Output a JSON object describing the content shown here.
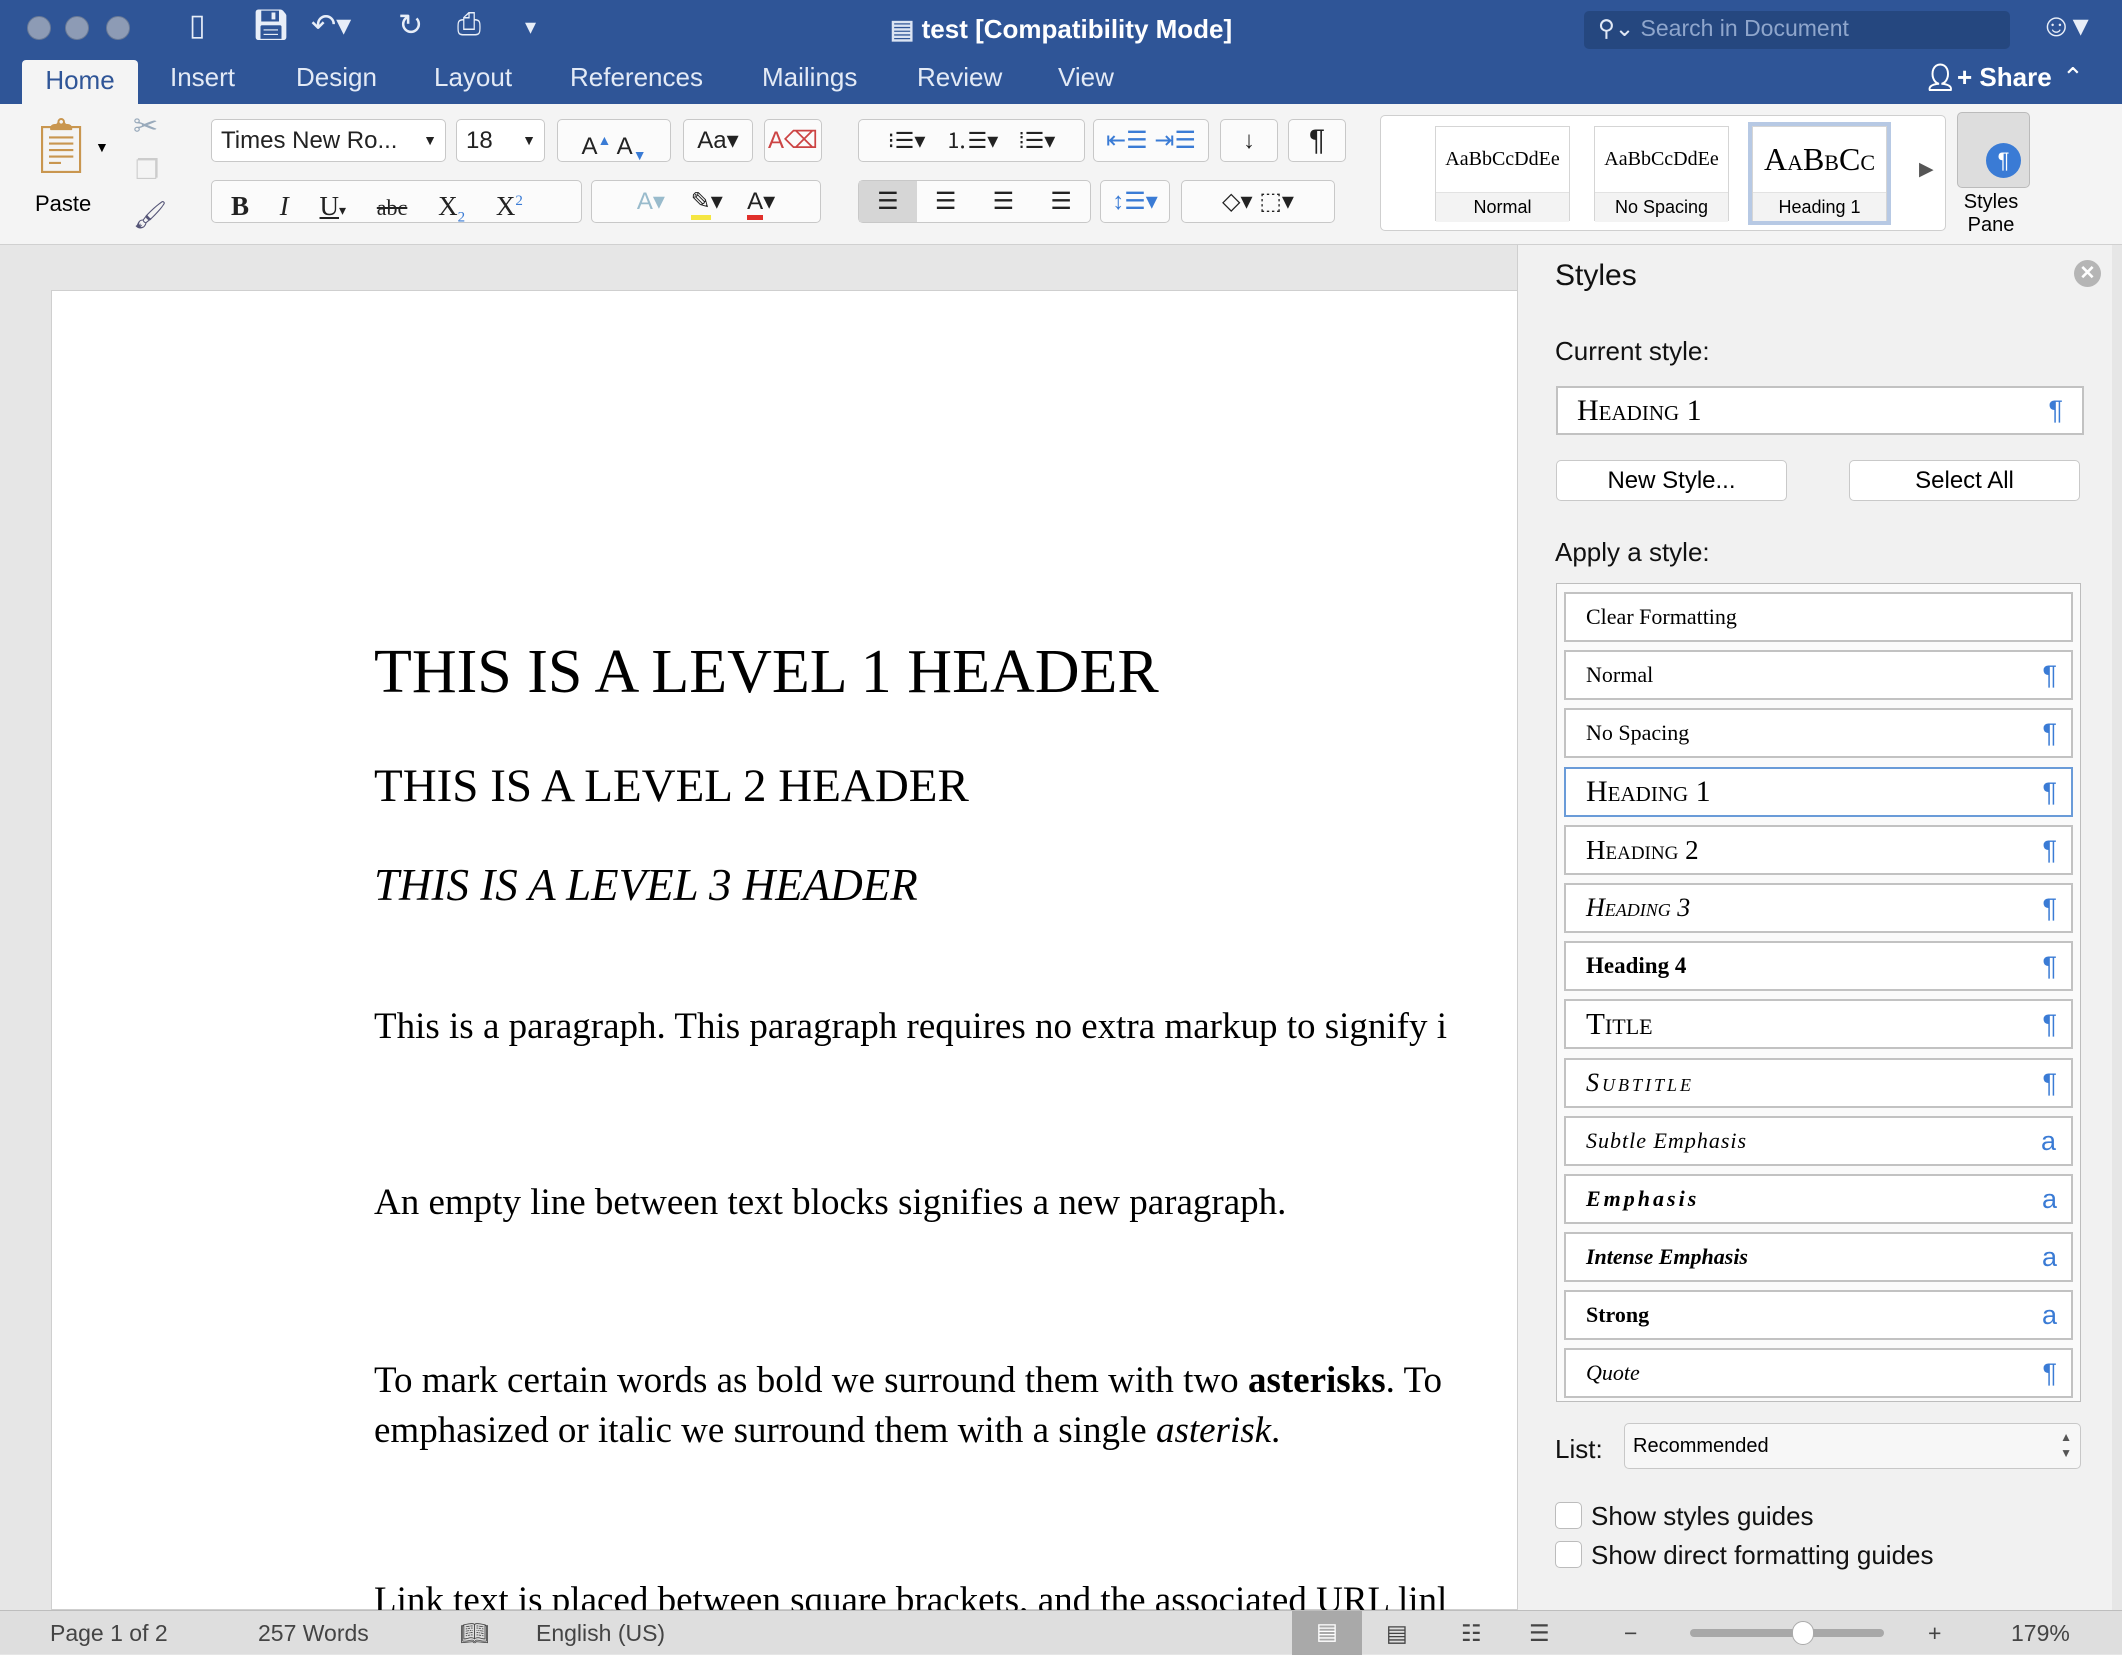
{
  "window": {
    "title": "test [Compatibility Mode]",
    "search_placeholder": "Search in Document",
    "share_label": "Share"
  },
  "tabs": [
    {
      "label": "Home",
      "active": true
    },
    {
      "label": "Insert"
    },
    {
      "label": "Design"
    },
    {
      "label": "Layout"
    },
    {
      "label": "References"
    },
    {
      "label": "Mailings"
    },
    {
      "label": "Review"
    },
    {
      "label": "View"
    }
  ],
  "ribbon": {
    "paste_label": "Paste",
    "font_name": "Times New Ro...",
    "font_size": "18",
    "styles_pane_label": "Styles Pane",
    "gallery": [
      {
        "preview": "AaBbCcDdEe",
        "label": "Normal"
      },
      {
        "preview": "AaBbCcDdEe",
        "label": "No Spacing"
      },
      {
        "preview": "AaBbCc",
        "label": "Heading 1",
        "selected": true
      }
    ]
  },
  "document": {
    "h1": "THIS IS A LEVEL 1 HEADER",
    "h2": "THIS IS A LEVEL 2 HEADER",
    "h3": "THIS IS A LEVEL 3 HEADER",
    "p1": "This is a paragraph. This paragraph requires no extra markup to signify i",
    "p2": "An empty line between text blocks signifies a new paragraph.",
    "p3_a": "To mark certain words as bold we surround them with two ",
    "p3_bold": "asterisks",
    "p3_b": ". To",
    "p3_c": "emphasized or italic we surround them with a single ",
    "p3_italic": "asterisk",
    "p3_d": ".",
    "p4": "Link text is placed between square brackets, and the associated URL linl"
  },
  "styles_pane": {
    "title": "Styles",
    "current_style_label": "Current style:",
    "current_style": "Heading 1",
    "new_style": "New Style...",
    "select_all": "Select All",
    "apply_label": "Apply a style:",
    "styles": [
      {
        "name": "Clear Formatting",
        "marker": ""
      },
      {
        "name": "Normal",
        "marker": "¶"
      },
      {
        "name": "No Spacing",
        "marker": "¶"
      },
      {
        "name": "Heading 1",
        "marker": "¶",
        "selected": true
      },
      {
        "name": "Heading 2",
        "marker": "¶"
      },
      {
        "name": "Heading 3",
        "marker": "¶"
      },
      {
        "name": "Heading 4",
        "marker": "¶"
      },
      {
        "name": "Title",
        "marker": "¶"
      },
      {
        "name": "Subtitle",
        "marker": "¶"
      },
      {
        "name": "Subtle Emphasis",
        "marker": "a"
      },
      {
        "name": "Emphasis",
        "marker": "a"
      },
      {
        "name": "Intense Emphasis",
        "marker": "a"
      },
      {
        "name": "Strong",
        "marker": "a"
      },
      {
        "name": "Quote",
        "marker": "¶"
      }
    ],
    "list_label": "List:",
    "list_value": "Recommended",
    "show_styles_guides": "Show styles guides",
    "show_direct_formatting_guides": "Show direct formatting guides"
  },
  "status": {
    "page": "Page 1 of 2",
    "words": "257 Words",
    "language": "English (US)",
    "zoom": "179%",
    "zoom_level": 0.58
  },
  "colors": {
    "accent": "#2f5597",
    "marker": "#3a7bd5"
  }
}
